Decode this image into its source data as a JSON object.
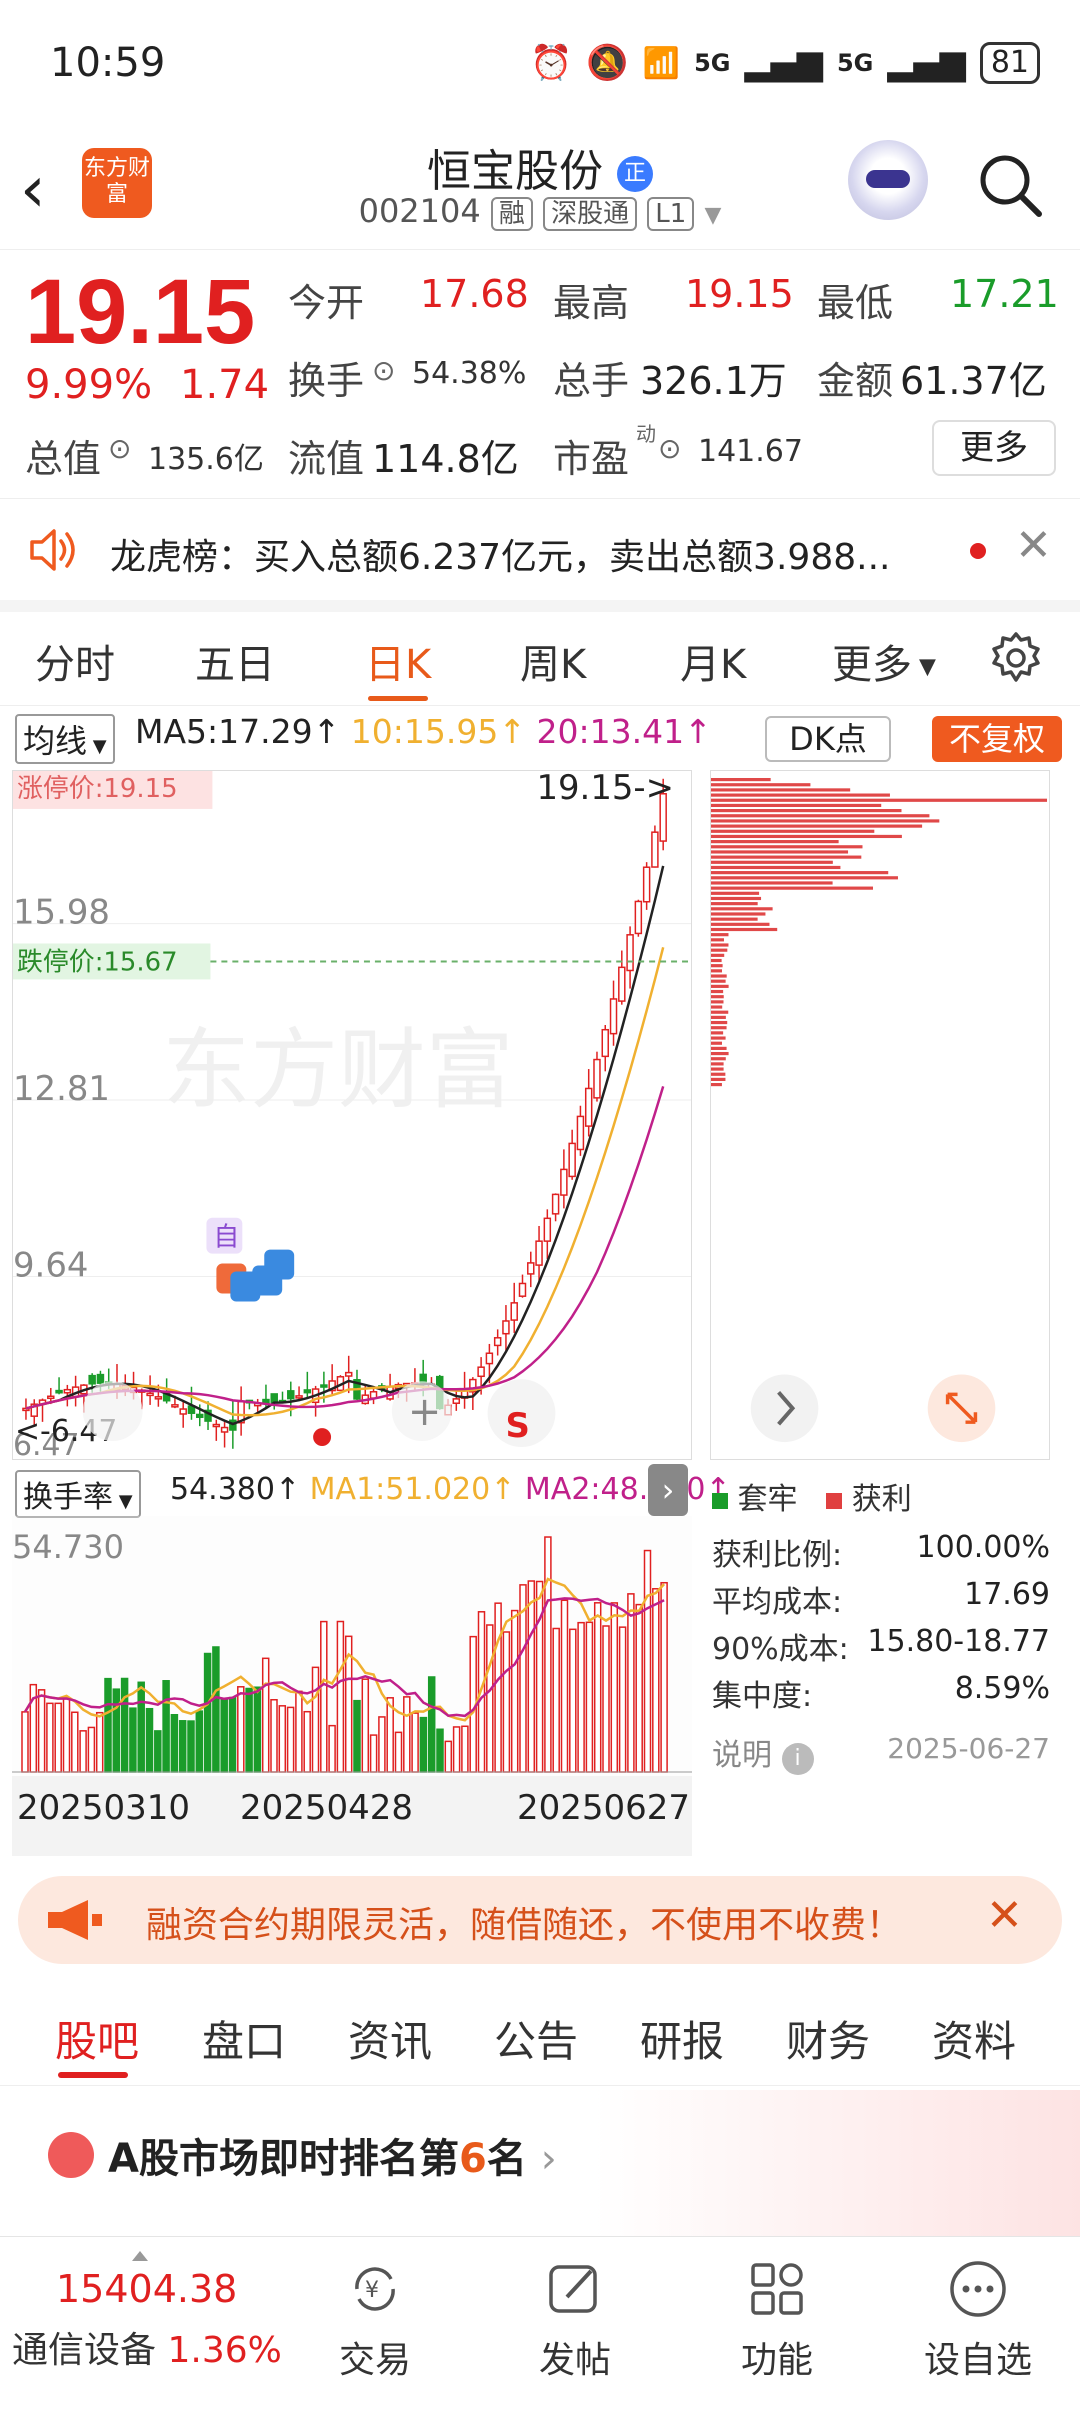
{
  "status": {
    "time": "10:59",
    "battery": "81",
    "signal1": "5G",
    "signal2": "5G"
  },
  "header": {
    "logo_text": "东方财富",
    "name": "恒宝股份",
    "name_tag": "正",
    "code": "002104",
    "badge1": "融",
    "badge2": "深股通",
    "badge3": "L1"
  },
  "quote": {
    "price": "19.15",
    "change_pct": "9.99%",
    "change": "1.74",
    "open_label": "今开",
    "open": "17.68",
    "high_label": "最高",
    "high": "19.15",
    "low_label": "最低",
    "low": "17.21",
    "turnover_label": "换手",
    "turnover": "54.38%",
    "volume_label": "总手",
    "volume": "326.1万",
    "amount_label": "金额",
    "amount": "61.37亿",
    "mktcap_label": "总值",
    "mktcap": "135.6亿",
    "float_label": "流值",
    "float": "114.8亿",
    "pe_label": "市盈",
    "pe_sup": "动",
    "pe": "141.67",
    "more": "更多"
  },
  "notice": {
    "text": "龙虎榜：买入总额6.237亿元，卖出总额3.988..."
  },
  "period_tabs": [
    "分时",
    "五日",
    "日K",
    "周K",
    "月K",
    "更多"
  ],
  "period_active": 2,
  "chart_header": {
    "indicator": "均线",
    "ma5": "MA5:17.29↑",
    "ma10": "10:15.95↑",
    "ma20": "20:13.41↑",
    "dk": "DK点",
    "adjust": "不复权"
  },
  "kline": {
    "limit_up": "涨停价:19.15",
    "limit_down": "跌停价:15.67",
    "last_marker": "19.15->",
    "ylabels": [
      "15.98",
      "12.81",
      "9.64",
      "6.47"
    ],
    "low_marker": "<-6.47",
    "watermark": "东方财富",
    "self_tag": "自",
    "colors": {
      "up": "#e02020",
      "down": "#1a9c2a",
      "ma5": "#222222",
      "ma10": "#f0b030",
      "ma20": "#c0208a"
    }
  },
  "volume": {
    "indicator": "换手率",
    "value": "54.380↑",
    "ma1": "MA1:51.020↑",
    "ma2": "MA2:48.080↑",
    "max_label": "54.730",
    "dates": [
      "20250310",
      "20250428",
      "20250627"
    ]
  },
  "chip": {
    "legend_trap": "套牢",
    "legend_profit": "获利",
    "rows": [
      {
        "label": "获利比例:",
        "value": "100.00%"
      },
      {
        "label": "平均成本:",
        "value": "17.69"
      },
      {
        "label": "90%成本:",
        "value": "15.80-18.77"
      },
      {
        "label": "集中度:",
        "value": "8.59%"
      }
    ],
    "note_label": "说明",
    "date": "2025-06-27"
  },
  "promo": {
    "text": "融资合约期限灵活，随借随还，不使用不收费！"
  },
  "bottom_tabs": [
    "股吧",
    "盘口",
    "资讯",
    "公告",
    "研报",
    "财务",
    "资料"
  ],
  "rank": {
    "prefix": "A股市场即时排名第",
    "rank": "6",
    "suffix": "名"
  },
  "bottom_nav": {
    "index_value": "15404.38",
    "index_name": "通信设备",
    "index_change": "1.36%",
    "items": [
      "交易",
      "发帖",
      "功能",
      "设自选"
    ]
  }
}
